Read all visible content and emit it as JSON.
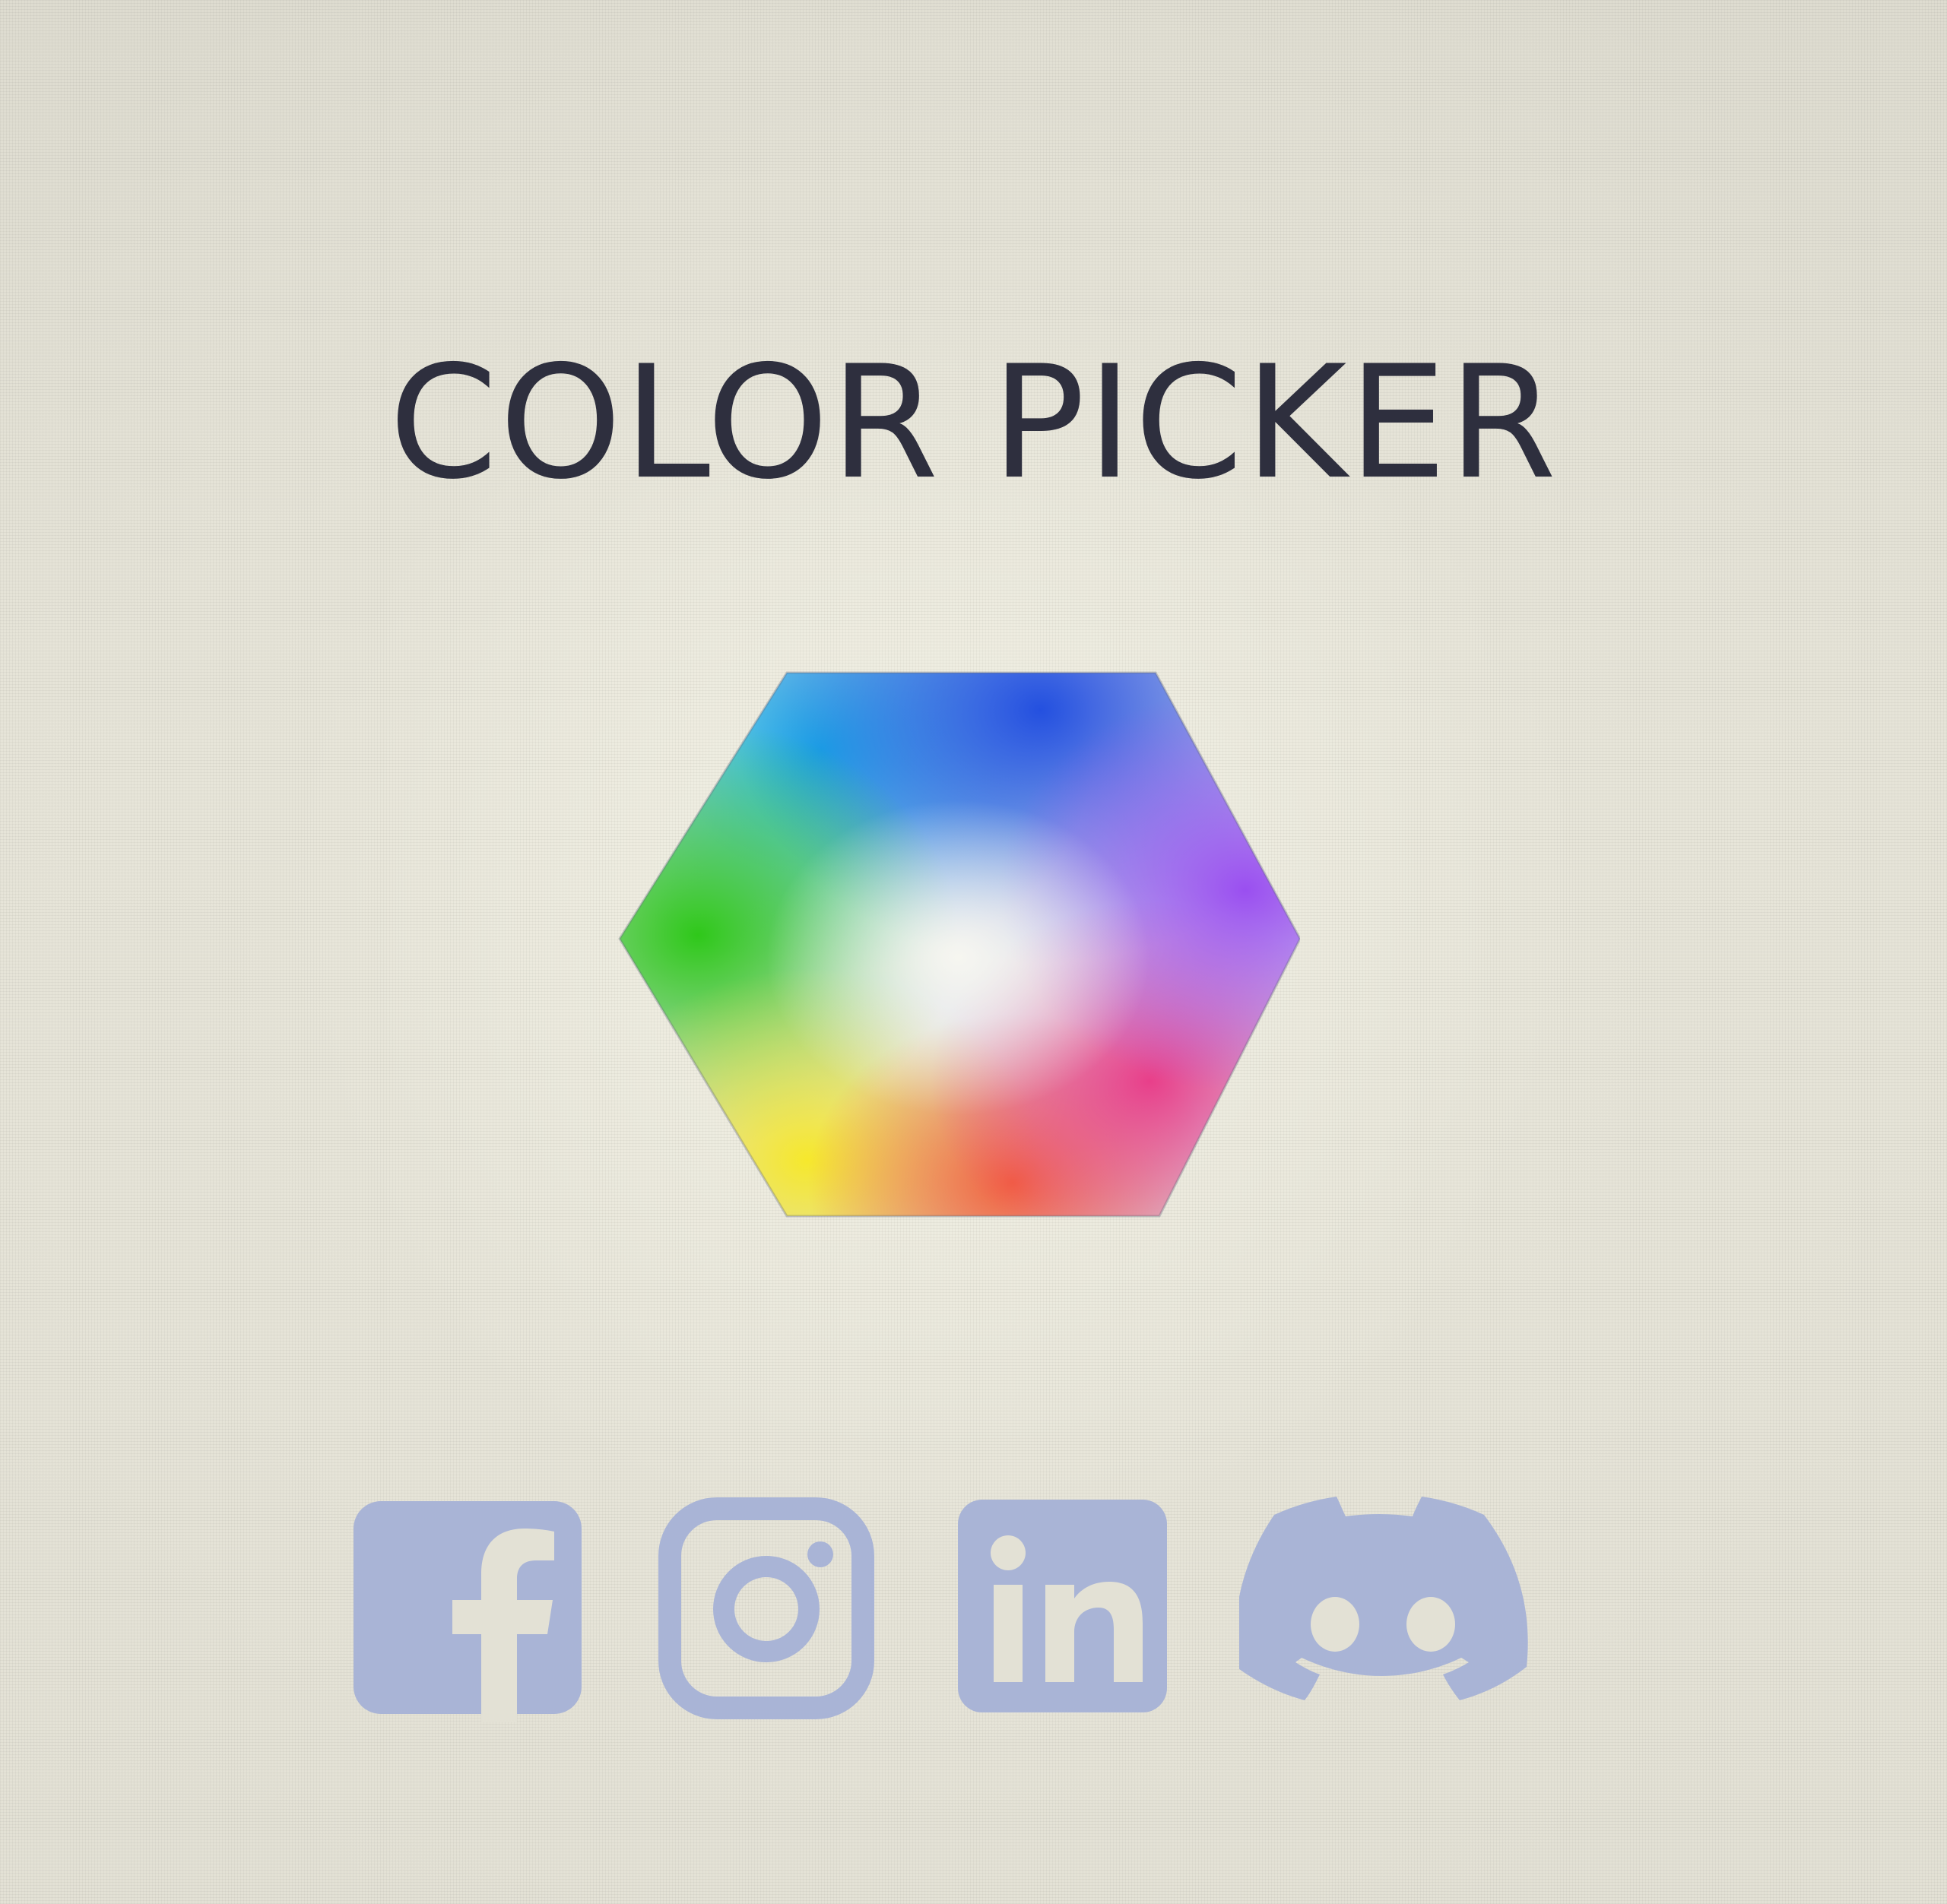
{
  "page": {
    "title": "COLOR PICKER"
  },
  "picker": {
    "icon": "color-picker-hexagon-icon",
    "colors": [
      "#2d6fe0",
      "#1fb8e0",
      "#3cc82a",
      "#f4e23a",
      "#f07a4a",
      "#e24d8c",
      "#9a52e8"
    ]
  },
  "socials": {
    "color": "#a9b4d6",
    "items": [
      {
        "icon": "facebook-icon"
      },
      {
        "icon": "instagram-icon"
      },
      {
        "icon": "linkedin-icon"
      },
      {
        "icon": "discord-icon"
      }
    ]
  }
}
